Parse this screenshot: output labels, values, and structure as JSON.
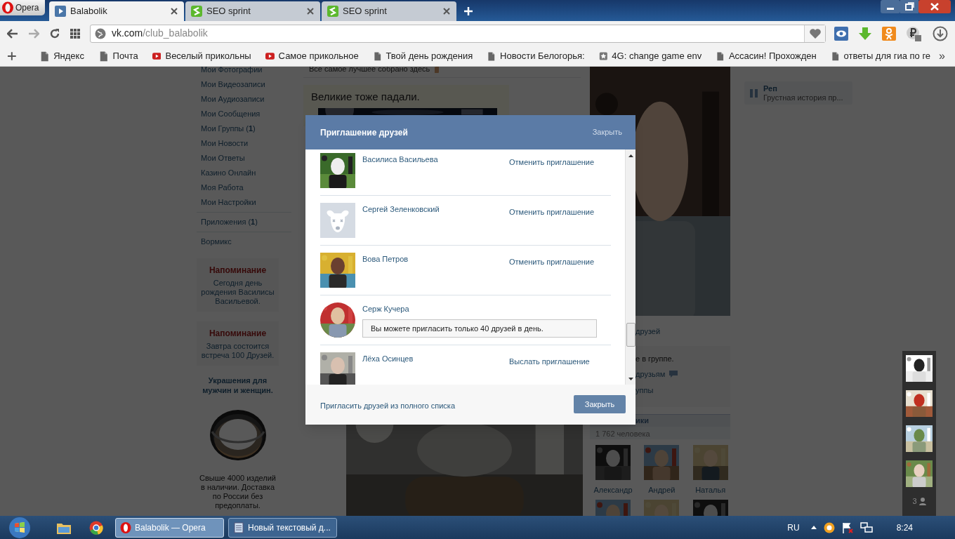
{
  "browser": {
    "menu_button": "Opera",
    "tabs": [
      {
        "title": "Balabolik",
        "selected": true,
        "kind": "vk"
      },
      {
        "title": "SEO sprint",
        "selected": false,
        "kind": "seo"
      },
      {
        "title": "SEO sprint",
        "selected": false,
        "kind": "seo"
      }
    ],
    "address": {
      "domain": "vk.com",
      "path": "/club_balabolik"
    },
    "bookmarks": [
      {
        "label": "Яндекс",
        "kind": "page"
      },
      {
        "label": "Почта",
        "kind": "page"
      },
      {
        "label": "Веселый прикольны",
        "kind": "video"
      },
      {
        "label": "Самое прикольное",
        "kind": "video"
      },
      {
        "label": "Твой день рождения",
        "kind": "page"
      },
      {
        "label": "Новости Белогорья:",
        "kind": "page"
      },
      {
        "label": "4G: change game env",
        "kind": "star"
      },
      {
        "label": "Ассасин! Прохожден",
        "kind": "page"
      },
      {
        "label": "ответы для гиа по ге",
        "kind": "page"
      }
    ],
    "more_bookmarks": "»"
  },
  "page": {
    "menu_groups": [
      [
        "Мои Фотографии",
        "Мои Видеозаписи",
        "Мои Аудиозаписи",
        "Мои Сообщения",
        "Мои Группы (**1**)",
        "Мои Новости",
        "Мои Ответы",
        "Казино Онлайн",
        "Моя Работа",
        "Мои Настройки"
      ],
      [
        "Приложения (**1**)"
      ],
      [
        "Вормикс"
      ]
    ],
    "reminders": [
      {
        "title": "Напоминание",
        "text": "Сегодня день рождения Василисы Васильевой."
      },
      {
        "title": "Напоминание",
        "text": "Завтра состоится встреча 100 Друзей."
      }
    ],
    "ad": {
      "title": "Украшения для мужчин и женщин.",
      "text": "Свыше 4000 изделий в наличии. Доставка по России без предоплаты."
    },
    "status": "Все самое лучшее собрано здесь",
    "post_title": "Великие тоже падали.",
    "right": {
      "friends_fragment": "друзей",
      "info_lines": [
        "е в группе.",
        "друзьям",
        "уппы"
      ],
      "members_header": "ики",
      "members_count": "1 762 человека",
      "members": [
        "Александр",
        "Андрей",
        "Наталья"
      ]
    },
    "audio": {
      "title": "Реп",
      "track": "Грустная история пр..."
    },
    "side_count": "3"
  },
  "dialog": {
    "title": "Приглашение друзей",
    "close_link": "Закрыть",
    "friends": [
      {
        "name": "Василиса Васильева",
        "kind": "invited",
        "action": "Отменить приглашение"
      },
      {
        "name": "Сергей Зеленковский",
        "kind": "invited",
        "action": "Отменить приглашение"
      },
      {
        "name": "Вова Петров",
        "kind": "invited",
        "action": "Отменить приглашение"
      },
      {
        "name": "Серж Кучера",
        "kind": "notice",
        "notice": "Вы можете пригласить только 40 друзей в день."
      },
      {
        "name": "Лёха Осинцев",
        "kind": "invite",
        "action": "Выслать приглашение"
      }
    ],
    "full_list_link": "Пригласить друзей из полного списка",
    "close_button": "Закрыть"
  },
  "taskbar": {
    "tasks": [
      {
        "title": "Balabolik — Opera",
        "selected": true
      },
      {
        "title": "Новый текстовый д...",
        "selected": false
      }
    ],
    "language": "RU",
    "time": "8:24"
  }
}
